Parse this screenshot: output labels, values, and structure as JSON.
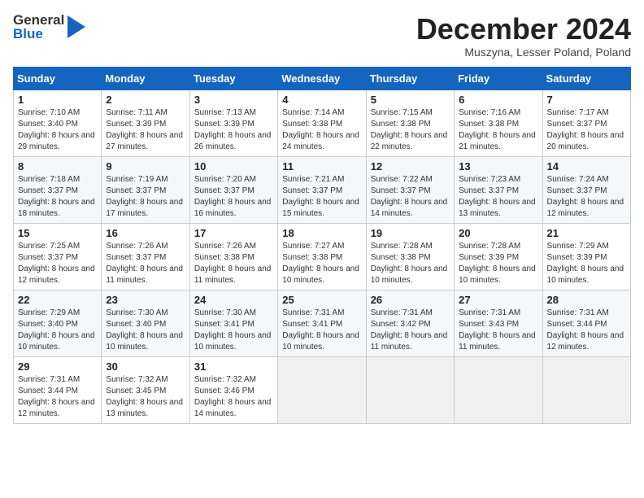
{
  "logo": {
    "general": "General",
    "blue": "Blue"
  },
  "title": "December 2024",
  "subtitle": "Muszyna, Lesser Poland, Poland",
  "days_of_week": [
    "Sunday",
    "Monday",
    "Tuesday",
    "Wednesday",
    "Thursday",
    "Friday",
    "Saturday"
  ],
  "weeks": [
    [
      {
        "day": "1",
        "sunrise": "Sunrise: 7:10 AM",
        "sunset": "Sunset: 3:40 PM",
        "daylight": "Daylight: 8 hours and 29 minutes."
      },
      {
        "day": "2",
        "sunrise": "Sunrise: 7:11 AM",
        "sunset": "Sunset: 3:39 PM",
        "daylight": "Daylight: 8 hours and 27 minutes."
      },
      {
        "day": "3",
        "sunrise": "Sunrise: 7:13 AM",
        "sunset": "Sunset: 3:39 PM",
        "daylight": "Daylight: 8 hours and 26 minutes."
      },
      {
        "day": "4",
        "sunrise": "Sunrise: 7:14 AM",
        "sunset": "Sunset: 3:38 PM",
        "daylight": "Daylight: 8 hours and 24 minutes."
      },
      {
        "day": "5",
        "sunrise": "Sunrise: 7:15 AM",
        "sunset": "Sunset: 3:38 PM",
        "daylight": "Daylight: 8 hours and 22 minutes."
      },
      {
        "day": "6",
        "sunrise": "Sunrise: 7:16 AM",
        "sunset": "Sunset: 3:38 PM",
        "daylight": "Daylight: 8 hours and 21 minutes."
      },
      {
        "day": "7",
        "sunrise": "Sunrise: 7:17 AM",
        "sunset": "Sunset: 3:37 PM",
        "daylight": "Daylight: 8 hours and 20 minutes."
      }
    ],
    [
      {
        "day": "8",
        "sunrise": "Sunrise: 7:18 AM",
        "sunset": "Sunset: 3:37 PM",
        "daylight": "Daylight: 8 hours and 18 minutes."
      },
      {
        "day": "9",
        "sunrise": "Sunrise: 7:19 AM",
        "sunset": "Sunset: 3:37 PM",
        "daylight": "Daylight: 8 hours and 17 minutes."
      },
      {
        "day": "10",
        "sunrise": "Sunrise: 7:20 AM",
        "sunset": "Sunset: 3:37 PM",
        "daylight": "Daylight: 8 hours and 16 minutes."
      },
      {
        "day": "11",
        "sunrise": "Sunrise: 7:21 AM",
        "sunset": "Sunset: 3:37 PM",
        "daylight": "Daylight: 8 hours and 15 minutes."
      },
      {
        "day": "12",
        "sunrise": "Sunrise: 7:22 AM",
        "sunset": "Sunset: 3:37 PM",
        "daylight": "Daylight: 8 hours and 14 minutes."
      },
      {
        "day": "13",
        "sunrise": "Sunrise: 7:23 AM",
        "sunset": "Sunset: 3:37 PM",
        "daylight": "Daylight: 8 hours and 13 minutes."
      },
      {
        "day": "14",
        "sunrise": "Sunrise: 7:24 AM",
        "sunset": "Sunset: 3:37 PM",
        "daylight": "Daylight: 8 hours and 12 minutes."
      }
    ],
    [
      {
        "day": "15",
        "sunrise": "Sunrise: 7:25 AM",
        "sunset": "Sunset: 3:37 PM",
        "daylight": "Daylight: 8 hours and 12 minutes."
      },
      {
        "day": "16",
        "sunrise": "Sunrise: 7:26 AM",
        "sunset": "Sunset: 3:37 PM",
        "daylight": "Daylight: 8 hours and 11 minutes."
      },
      {
        "day": "17",
        "sunrise": "Sunrise: 7:26 AM",
        "sunset": "Sunset: 3:38 PM",
        "daylight": "Daylight: 8 hours and 11 minutes."
      },
      {
        "day": "18",
        "sunrise": "Sunrise: 7:27 AM",
        "sunset": "Sunset: 3:38 PM",
        "daylight": "Daylight: 8 hours and 10 minutes."
      },
      {
        "day": "19",
        "sunrise": "Sunrise: 7:28 AM",
        "sunset": "Sunset: 3:38 PM",
        "daylight": "Daylight: 8 hours and 10 minutes."
      },
      {
        "day": "20",
        "sunrise": "Sunrise: 7:28 AM",
        "sunset": "Sunset: 3:39 PM",
        "daylight": "Daylight: 8 hours and 10 minutes."
      },
      {
        "day": "21",
        "sunrise": "Sunrise: 7:29 AM",
        "sunset": "Sunset: 3:39 PM",
        "daylight": "Daylight: 8 hours and 10 minutes."
      }
    ],
    [
      {
        "day": "22",
        "sunrise": "Sunrise: 7:29 AM",
        "sunset": "Sunset: 3:40 PM",
        "daylight": "Daylight: 8 hours and 10 minutes."
      },
      {
        "day": "23",
        "sunrise": "Sunrise: 7:30 AM",
        "sunset": "Sunset: 3:40 PM",
        "daylight": "Daylight: 8 hours and 10 minutes."
      },
      {
        "day": "24",
        "sunrise": "Sunrise: 7:30 AM",
        "sunset": "Sunset: 3:41 PM",
        "daylight": "Daylight: 8 hours and 10 minutes."
      },
      {
        "day": "25",
        "sunrise": "Sunrise: 7:31 AM",
        "sunset": "Sunset: 3:41 PM",
        "daylight": "Daylight: 8 hours and 10 minutes."
      },
      {
        "day": "26",
        "sunrise": "Sunrise: 7:31 AM",
        "sunset": "Sunset: 3:42 PM",
        "daylight": "Daylight: 8 hours and 11 minutes."
      },
      {
        "day": "27",
        "sunrise": "Sunrise: 7:31 AM",
        "sunset": "Sunset: 3:43 PM",
        "daylight": "Daylight: 8 hours and 11 minutes."
      },
      {
        "day": "28",
        "sunrise": "Sunrise: 7:31 AM",
        "sunset": "Sunset: 3:44 PM",
        "daylight": "Daylight: 8 hours and 12 minutes."
      }
    ],
    [
      {
        "day": "29",
        "sunrise": "Sunrise: 7:31 AM",
        "sunset": "Sunset: 3:44 PM",
        "daylight": "Daylight: 8 hours and 12 minutes."
      },
      {
        "day": "30",
        "sunrise": "Sunrise: 7:32 AM",
        "sunset": "Sunset: 3:45 PM",
        "daylight": "Daylight: 8 hours and 13 minutes."
      },
      {
        "day": "31",
        "sunrise": "Sunrise: 7:32 AM",
        "sunset": "Sunset: 3:46 PM",
        "daylight": "Daylight: 8 hours and 14 minutes."
      },
      null,
      null,
      null,
      null
    ]
  ]
}
